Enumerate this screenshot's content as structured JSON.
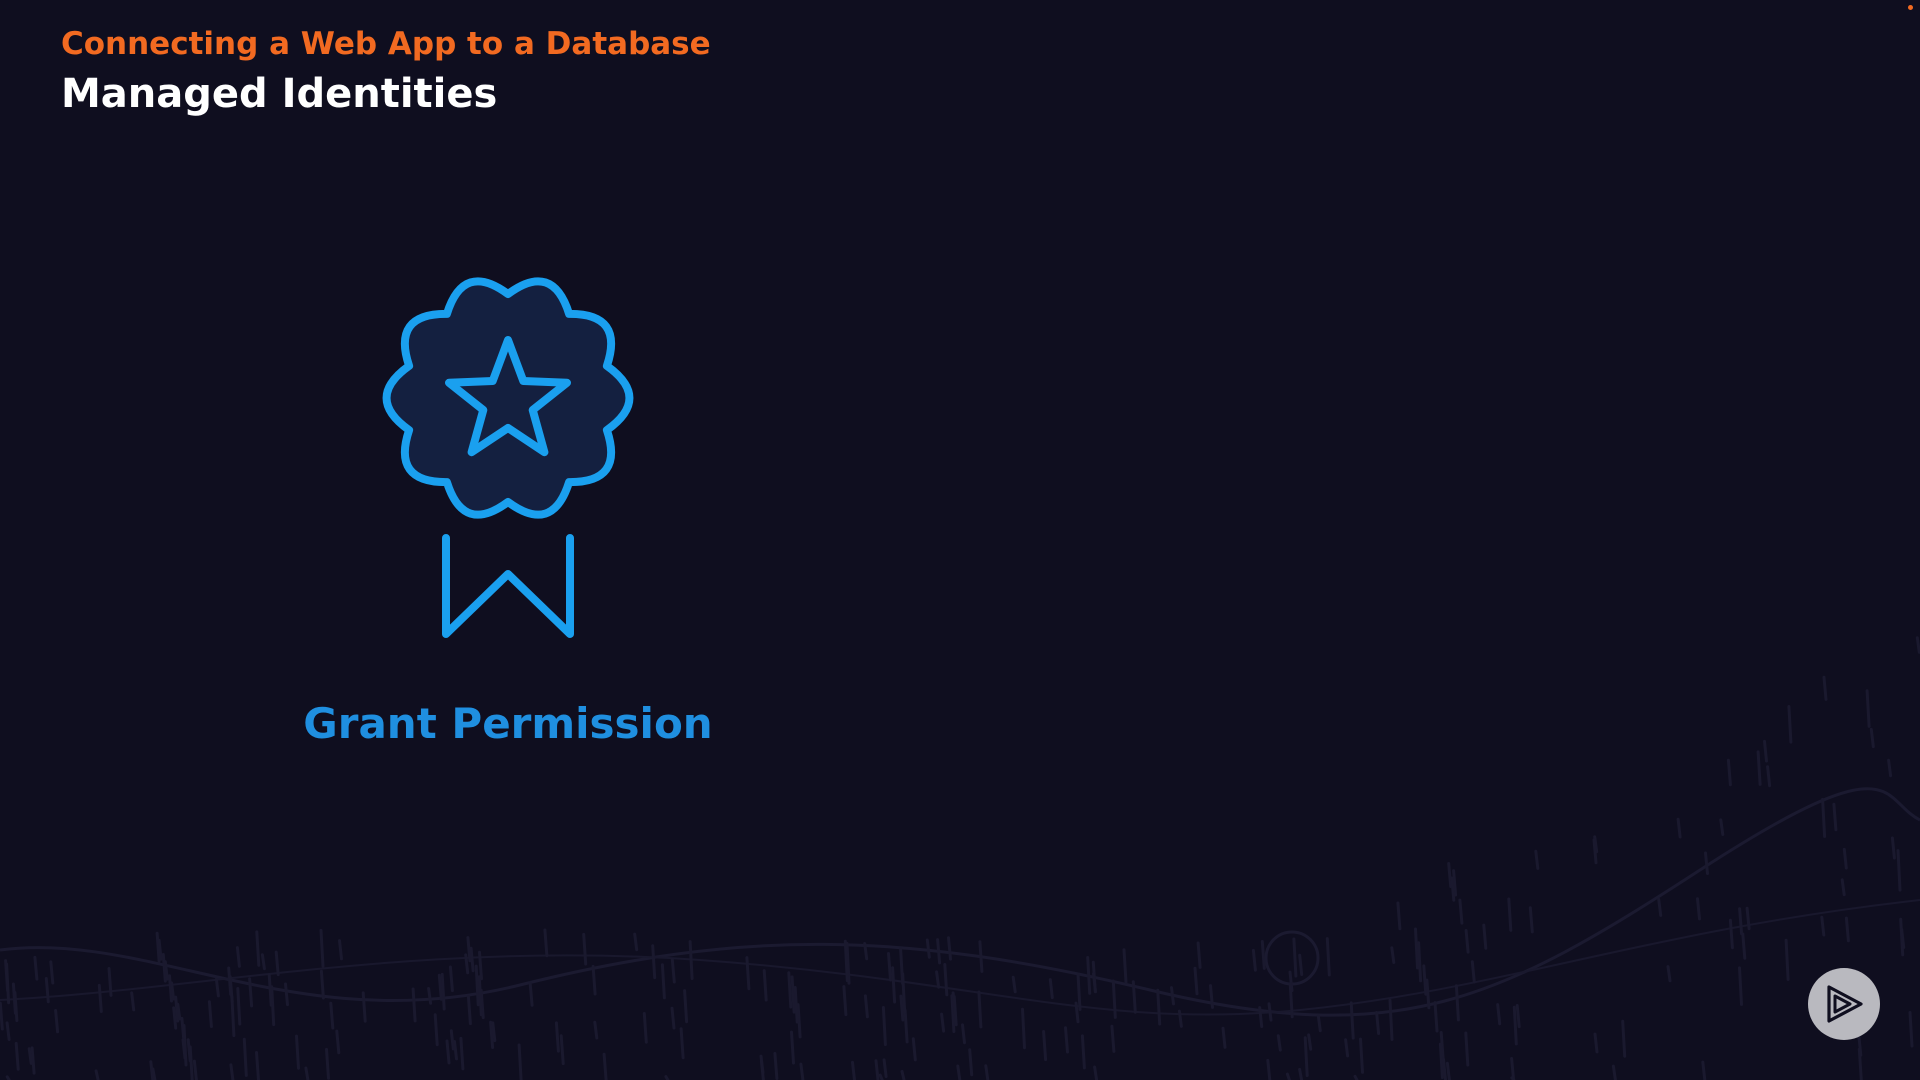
{
  "header": {
    "course_title": "Connecting a Web App to a Database",
    "section_title": "Managed Identities"
  },
  "main": {
    "badge_icon": "award-ribbon-star-icon",
    "badge_caption": "Grant Permission"
  },
  "footer": {
    "logo_icon": "play-logo-icon"
  },
  "colors": {
    "background": "#0f0e1f",
    "accent_orange": "#f26a21",
    "title_white": "#ffffff",
    "icon_blue": "#1aa0ef",
    "caption_blue": "#1f8fe0",
    "badge_fill": "#142040",
    "logo_bg": "#b9b9bf",
    "logo_fg": "#0f0e1f"
  }
}
